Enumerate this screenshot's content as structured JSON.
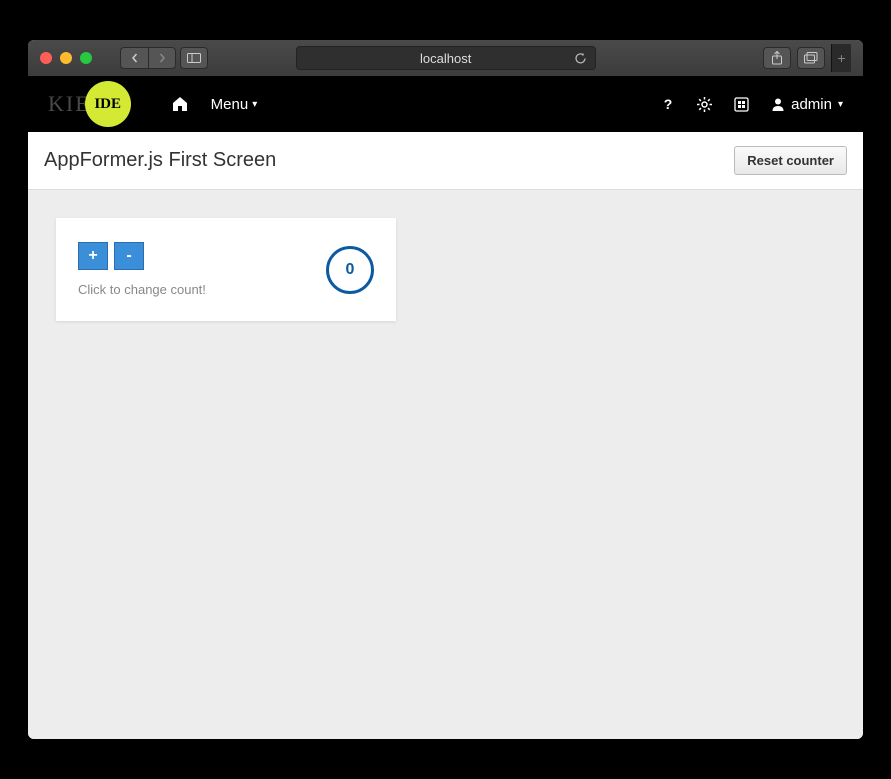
{
  "browser": {
    "address": "localhost"
  },
  "logo": {
    "kie": "KIE",
    "ide": "IDE"
  },
  "navbar": {
    "menu_label": "Menu",
    "user_label": "admin"
  },
  "page": {
    "title": "AppFormer.js First Screen",
    "reset_label": "Reset counter"
  },
  "counter": {
    "plus_label": "+",
    "minus_label": "-",
    "hint": "Click to change count!",
    "value": "0"
  }
}
